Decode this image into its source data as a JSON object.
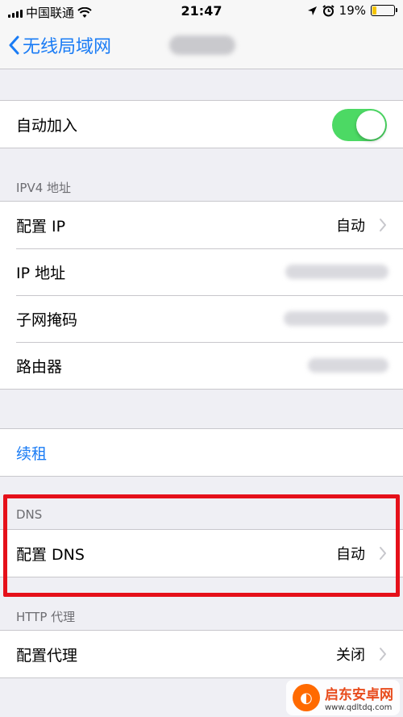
{
  "status_bar": {
    "carrier": "中国联通",
    "time": "21:47",
    "battery": "19%",
    "battery_level": 0.19
  },
  "nav": {
    "back_label": "无线局域网"
  },
  "auto_join": {
    "label": "自动加入",
    "enabled": true
  },
  "ipv4": {
    "header": "IPV4 地址",
    "rows": [
      {
        "label": "配置 IP",
        "value": "自动"
      },
      {
        "label": "IP 地址"
      },
      {
        "label": "子网掩码"
      },
      {
        "label": "路由器"
      }
    ]
  },
  "renew": {
    "label": "续租"
  },
  "dns": {
    "header": "DNS",
    "label": "配置 DNS",
    "value": "自动"
  },
  "http_proxy": {
    "header": "HTTP 代理",
    "label": "配置代理",
    "value": "关闭"
  },
  "watermark": {
    "name": "启东安卓网",
    "url": "www.qdltdq.com"
  },
  "colors": {
    "accent": "#1a7cf5",
    "toggle_on": "#4cd964",
    "highlight": "#e5101a"
  }
}
